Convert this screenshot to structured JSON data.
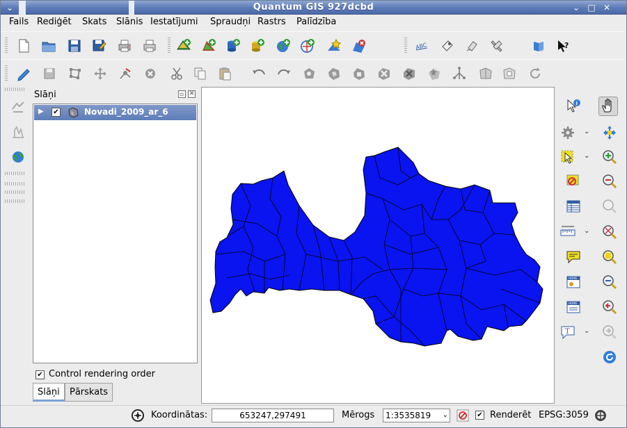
{
  "window": {
    "title": "Quantum GIS 927dcbd"
  },
  "menu": [
    "Fails",
    "Rediģēt",
    "Skats",
    "Slānis",
    "Iestatījumi",
    "Spraudņi",
    "Rastrs",
    "Palīdzība"
  ],
  "layers_panel": {
    "title": "Slāņi",
    "layers": [
      {
        "name": "Novadi_2009_ar_6",
        "visible": true
      }
    ],
    "control_rendering_order": {
      "label": "Control rendering order",
      "checked": true
    },
    "tabs": [
      {
        "label": "Slāņi",
        "active": true
      },
      {
        "label": "Pārskats",
        "active": false
      }
    ]
  },
  "status": {
    "coords_label": "Koordinātas:",
    "coords_value": "653247,297491",
    "scale_label": "Mērogs",
    "scale_value": "1:3535819",
    "render_label": "Renderēt",
    "render_checked": true,
    "crs": "EPSG:3059"
  },
  "colors": {
    "map_fill": "#0a14f0",
    "map_border": "#000000",
    "titlebar": "#5b79b6",
    "selection": "#6f8cc4"
  },
  "icons": {
    "toolbar_file": [
      "new-project-icon",
      "open-project-icon",
      "save-project-icon",
      "save-as-icon",
      "print-composer-icon",
      "print-icon"
    ],
    "toolbar_layers": [
      "add-vector-layer-icon",
      "add-raster-layer-icon",
      "add-postgis-layer-icon",
      "add-spatialite-layer-icon",
      "add-wms-layer-icon",
      "add-wfs-layer-icon",
      "new-vector-layer-icon",
      "remove-layer-icon"
    ],
    "toolbar_misc": [
      "label-icon",
      "plugin-manager-icon",
      "python-plugin-icon",
      "settings-icon",
      "help-contents-icon",
      "whats-this-icon"
    ],
    "toolbar_edit": [
      "toggle-editing-icon",
      "save-edits-icon",
      "capture-polygon-icon",
      "move-feature-icon",
      "node-tool-icon",
      "delete-selected-icon",
      "cut-features-icon",
      "copy-features-icon",
      "paste-features-icon",
      "undo-icon",
      "redo-icon",
      "add-ring-icon",
      "add-island-icon",
      "simplify-icon",
      "delete-ring-icon",
      "delete-part-icon",
      "reshape-icon",
      "split-features-icon",
      "merge-features-icon",
      "rotate-point-symbols-icon",
      "refresh-icon"
    ]
  }
}
